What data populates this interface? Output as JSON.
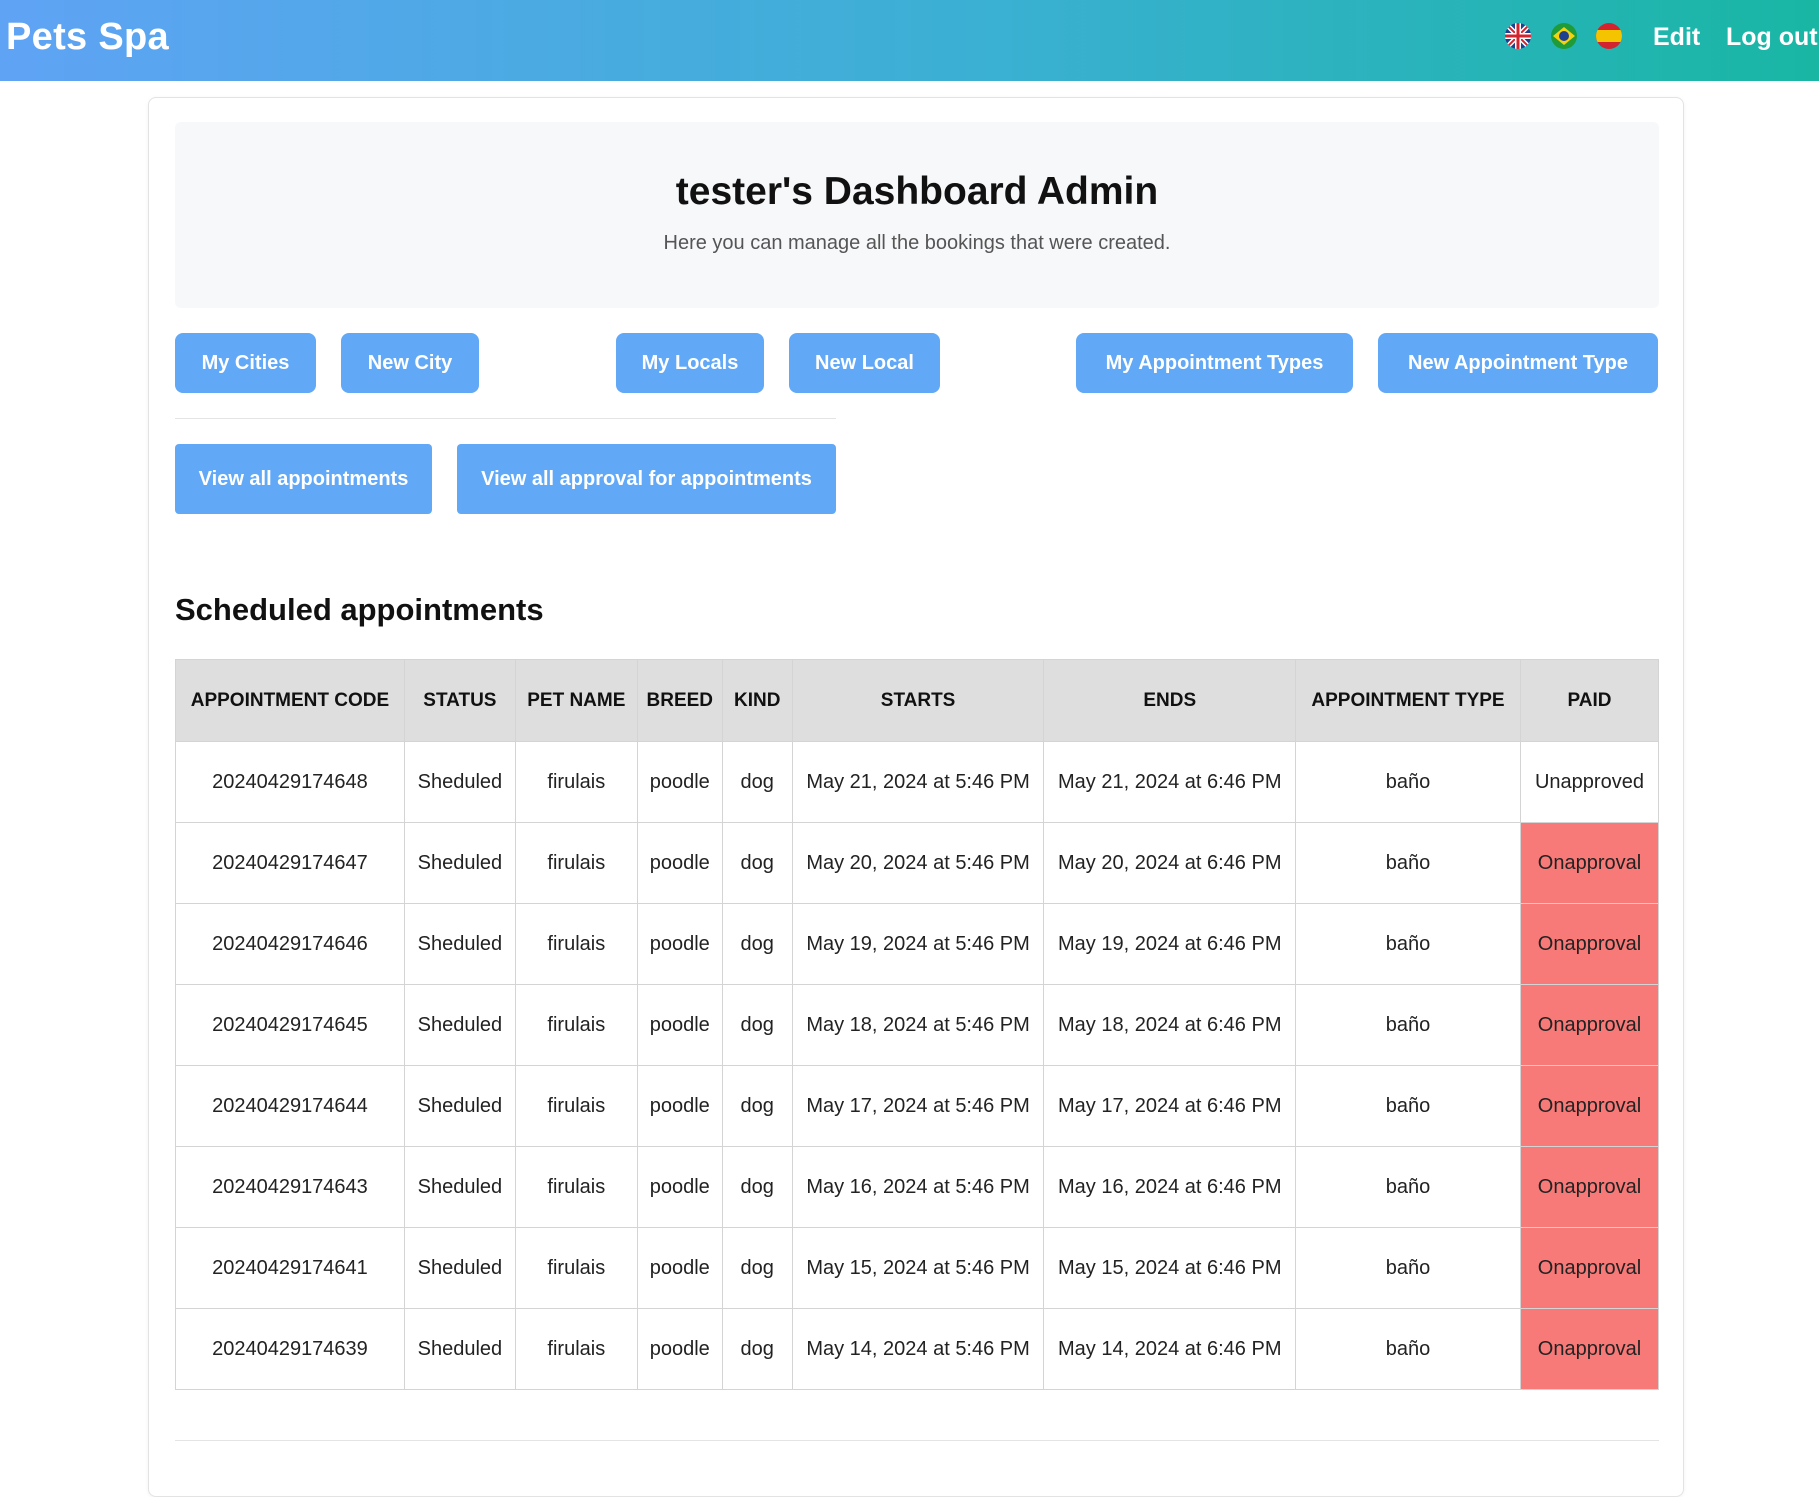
{
  "navbar": {
    "brand": "Pets Spa",
    "flags": [
      {
        "name": "uk-flag-icon",
        "language": "English"
      },
      {
        "name": "brazil-flag-icon",
        "language": "Portuguese"
      },
      {
        "name": "spain-flag-icon",
        "language": "Spanish"
      }
    ],
    "edit_label": "Edit",
    "logout_label": "Log out"
  },
  "hero": {
    "title": "tester's Dashboard Admin",
    "subtitle": "Here you can manage all the bookings that were created."
  },
  "buttons": {
    "my_cities": "My Cities",
    "new_city": "New City",
    "my_locals": "My Locals",
    "new_local": "New Local",
    "my_appointment_types": "My Appointment Types",
    "new_appointment_type": "New Appointment Type",
    "view_all_appointments": "View all appointments",
    "view_all_approval": "View all approval for appointments"
  },
  "section_title": "Scheduled appointments",
  "table": {
    "headers": [
      "APPOINTMENT CODE",
      "STATUS",
      "PET NAME",
      "BREED",
      "KIND",
      "STARTS",
      "ENDS",
      "APPOINTMENT TYPE",
      "PAID"
    ],
    "rows": [
      [
        "20240429174648",
        "Sheduled",
        "firulais",
        "poodle",
        "dog",
        "May 21, 2024 at 5:46 PM",
        "May 21, 2024 at 6:46 PM",
        "baño",
        "Unapproved"
      ],
      [
        "20240429174647",
        "Sheduled",
        "firulais",
        "poodle",
        "dog",
        "May 20, 2024 at 5:46 PM",
        "May 20, 2024 at 6:46 PM",
        "baño",
        "Onapproval"
      ],
      [
        "20240429174646",
        "Sheduled",
        "firulais",
        "poodle",
        "dog",
        "May 19, 2024 at 5:46 PM",
        "May 19, 2024 at 6:46 PM",
        "baño",
        "Onapproval"
      ],
      [
        "20240429174645",
        "Sheduled",
        "firulais",
        "poodle",
        "dog",
        "May 18, 2024 at 5:46 PM",
        "May 18, 2024 at 6:46 PM",
        "baño",
        "Onapproval"
      ],
      [
        "20240429174644",
        "Sheduled",
        "firulais",
        "poodle",
        "dog",
        "May 17, 2024 at 5:46 PM",
        "May 17, 2024 at 6:46 PM",
        "baño",
        "Onapproval"
      ],
      [
        "20240429174643",
        "Sheduled",
        "firulais",
        "poodle",
        "dog",
        "May 16, 2024 at 5:46 PM",
        "May 16, 2024 at 6:46 PM",
        "baño",
        "Onapproval"
      ],
      [
        "20240429174641",
        "Sheduled",
        "firulais",
        "poodle",
        "dog",
        "May 15, 2024 at 5:46 PM",
        "May 15, 2024 at 6:46 PM",
        "baño",
        "Onapproval"
      ],
      [
        "20240429174639",
        "Sheduled",
        "firulais",
        "poodle",
        "dog",
        "May 14, 2024 at 5:46 PM",
        "May 14, 2024 at 6:46 PM",
        "baño",
        "Onapproval"
      ]
    ]
  },
  "colors": {
    "navbar_start": "#5fa3f5",
    "navbar_end": "#19b6a4",
    "button": "#61a8f7",
    "onapproval": "#f87a78",
    "table_header": "#dedede"
  }
}
